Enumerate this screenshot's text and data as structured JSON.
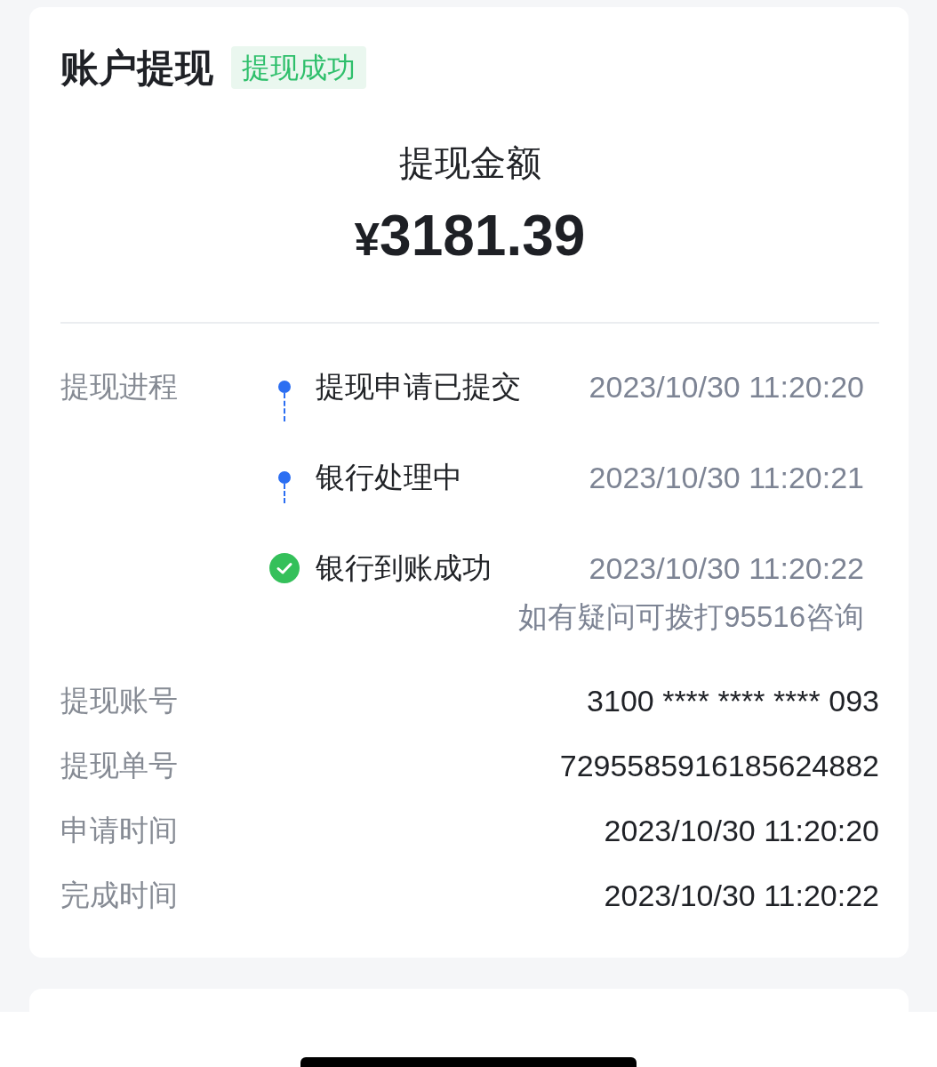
{
  "header": {
    "title": "账户提现",
    "status_badge": "提现成功"
  },
  "amount": {
    "label": "提现金额",
    "value": "¥3181.39"
  },
  "progress": {
    "label": "提现进程",
    "steps": [
      {
        "kind": "dot",
        "title": "提现申请已提交",
        "time": "2023/10/30 11:20:20"
      },
      {
        "kind": "dot",
        "title": "银行处理中",
        "time": "2023/10/30 11:20:21"
      },
      {
        "kind": "check",
        "title": "银行到账成功",
        "time": "2023/10/30 11:20:22"
      }
    ],
    "note": "如有疑问可拨打95516咨询"
  },
  "details": [
    {
      "label": "提现账号",
      "value": "3100 **** **** **** 093"
    },
    {
      "label": "提现单号",
      "value": "7295585916185624882"
    },
    {
      "label": "申请时间",
      "value": "2023/10/30 11:20:20"
    },
    {
      "label": "完成时间",
      "value": "2023/10/30 11:20:22"
    }
  ]
}
